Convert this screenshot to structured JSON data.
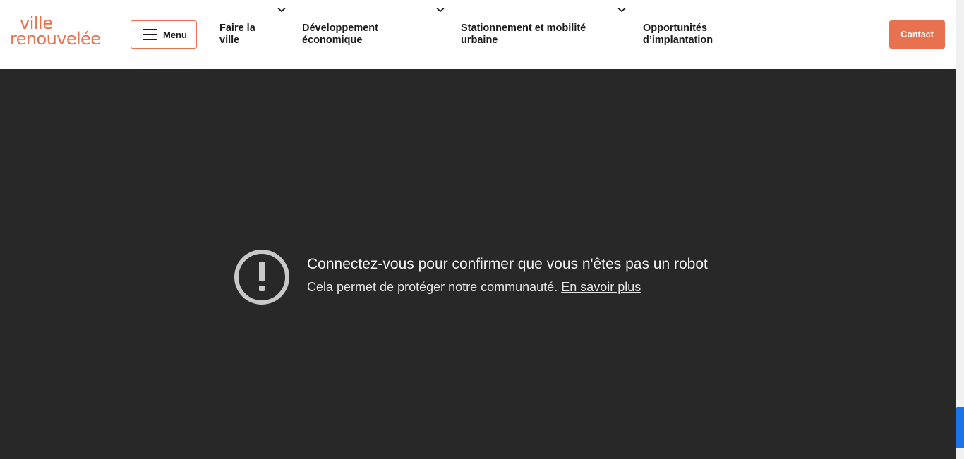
{
  "header": {
    "logo_line1": "ville",
    "logo_line2": "renouvelée",
    "menu_label": "Menu",
    "nav": [
      {
        "line1": "Faire la",
        "line2": "ville"
      },
      {
        "line1": "Développement",
        "line2": "économique"
      },
      {
        "line1": "Stationnement et mobilité",
        "line2": "urbaine"
      },
      {
        "line1": "Opportunités",
        "line2": "d’implantation"
      }
    ],
    "contact_label": "Contact"
  },
  "notice": {
    "title": "Connectez-vous pour confirmer que vous n'êtes pas un robot",
    "subtitle": "Cela permet de protéger notre communauté.",
    "link": "En savoir plus"
  },
  "colors": {
    "brand": "#e8714f",
    "background_dark": "#282828",
    "accent_blue": "#1a73e8"
  }
}
